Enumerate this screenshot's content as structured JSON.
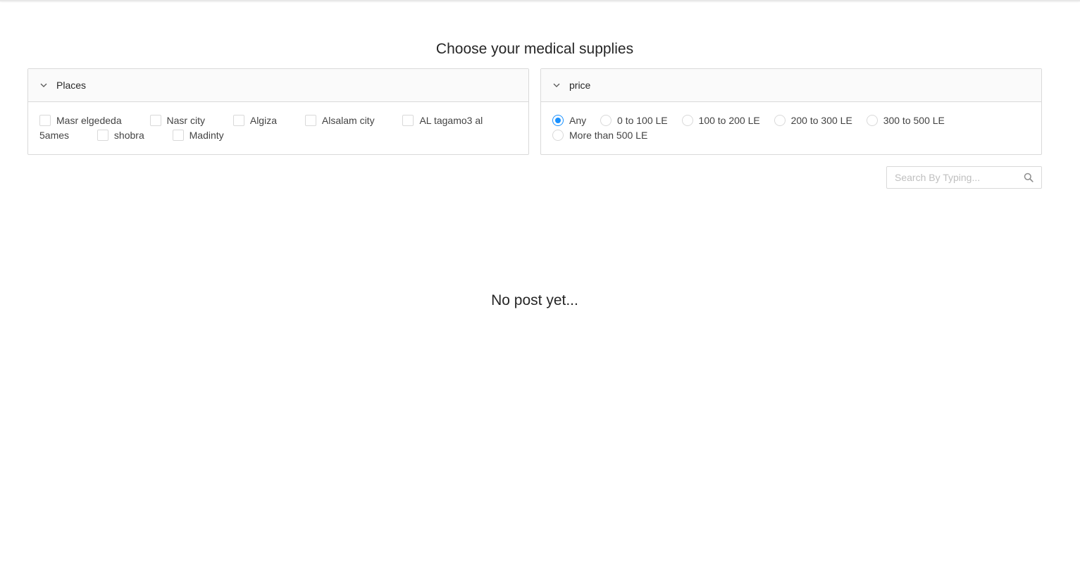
{
  "page": {
    "title": "Choose your medical supplies",
    "empty_message": "No post yet..."
  },
  "filters": {
    "places": {
      "header": "Places",
      "options": [
        {
          "label": "Masr elgededa",
          "checked": false
        },
        {
          "label": "Nasr city",
          "checked": false
        },
        {
          "label": "Algiza",
          "checked": false
        },
        {
          "label": "Alsalam city",
          "checked": false
        },
        {
          "label": "AL tagamo3 al 5ames",
          "checked": false
        },
        {
          "label": "shobra",
          "checked": false
        },
        {
          "label": "Madinty",
          "checked": false
        }
      ]
    },
    "price": {
      "header": "price",
      "selected": "Any",
      "options": [
        {
          "label": "Any",
          "checked": true
        },
        {
          "label": "0 to 100 LE",
          "checked": false
        },
        {
          "label": "100 to 200 LE",
          "checked": false
        },
        {
          "label": "200 to 300 LE",
          "checked": false
        },
        {
          "label": "300 to 500 LE",
          "checked": false
        },
        {
          "label": "More than 500 LE",
          "checked": false
        }
      ]
    }
  },
  "search": {
    "placeholder": "Search By Typing...",
    "value": "",
    "icon": "search-icon"
  },
  "colors": {
    "accent": "#1890ff",
    "border": "#d9d9d9",
    "header_bg": "#fafafa"
  },
  "icons": {
    "collapse": "chevron-down-icon"
  }
}
